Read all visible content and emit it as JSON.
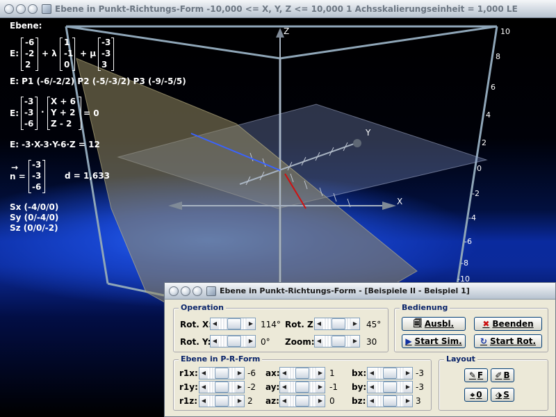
{
  "main_window": {
    "title": "Ebene in Punkt-Richtungs-Form   -10,000 <= X, Y, Z <= 10,000    1 Achsskalierungseinheit = 1,000 LE"
  },
  "overlay": {
    "heading": "Ebene:",
    "param_prefix": "E:",
    "lambda_term": "+ λ",
    "mu_term": "+ μ",
    "vec_point": [
      "-6",
      "-2",
      "2"
    ],
    "vec_dir1": [
      "1",
      "-1",
      "0"
    ],
    "vec_dir2": [
      "-3",
      "-3",
      "3"
    ],
    "points_line": "E: P1 (-6/-2/2)   P2 (-5/-3/2)   P3 (-9/-5/5)",
    "normal_prefix": "E:",
    "normal_vec": [
      "-3",
      "-3",
      "-6"
    ],
    "dot": "·",
    "diff_vec": [
      "X + 6",
      "Y + 2",
      "Z - 2"
    ],
    "eq_zero": "= 0",
    "coord_line": "E: -3·X-3·Y-6·Z = 12",
    "n_arrow": "→",
    "n_label": "n =",
    "n_vec": [
      "-3",
      "-3",
      "-6"
    ],
    "distance": "d = 1,633",
    "sx": "Sx (-4/0/0)",
    "sy": "Sy (0/-4/0)",
    "sz": "Sz (0/0/-2)"
  },
  "axes": {
    "x": "X",
    "y": "Y",
    "z": "Z",
    "ticks": [
      "10",
      "8",
      "6",
      "4",
      "2",
      "0",
      "-2",
      "-4",
      "-6",
      "-8",
      "-10"
    ]
  },
  "dialog": {
    "title": "Ebene in Punkt-Richtungs-Form - [Beispiele II - Beispiel 1]",
    "operation": {
      "label": "Operation",
      "rot_x_label": "Rot. X:",
      "rot_x_value": "114°",
      "rot_z_label": "Rot. Z:",
      "rot_z_value": "45°",
      "rot_y_label": "Rot. Y:",
      "rot_y_value": "0°",
      "zoom_label": "Zoom:",
      "zoom_value": "30"
    },
    "bedienung": {
      "label": "Bedienung",
      "ausbl": "Ausbl.",
      "beenden": "Beenden",
      "start_sim": "Start Sim.",
      "start_rot": "Start Rot."
    },
    "ebene": {
      "label": "Ebene in P-R-Form",
      "r1x_label": "r1x:",
      "r1x_value": "-6",
      "r1y_label": "r1y:",
      "r1y_value": "-2",
      "r1z_label": "r1z:",
      "r1z_value": "2",
      "ax_label": "ax:",
      "ax_value": "1",
      "ay_label": "ay:",
      "ay_value": "-1",
      "az_label": "az:",
      "az_value": "0",
      "bx_label": "bx:",
      "bx_value": "-3",
      "by_label": "by:",
      "by_value": "-3",
      "bz_label": "bz:",
      "bz_value": "3"
    },
    "layout": {
      "label": "Layout",
      "f": "F",
      "b": "B",
      "zero": "0",
      "s": "S"
    }
  }
}
